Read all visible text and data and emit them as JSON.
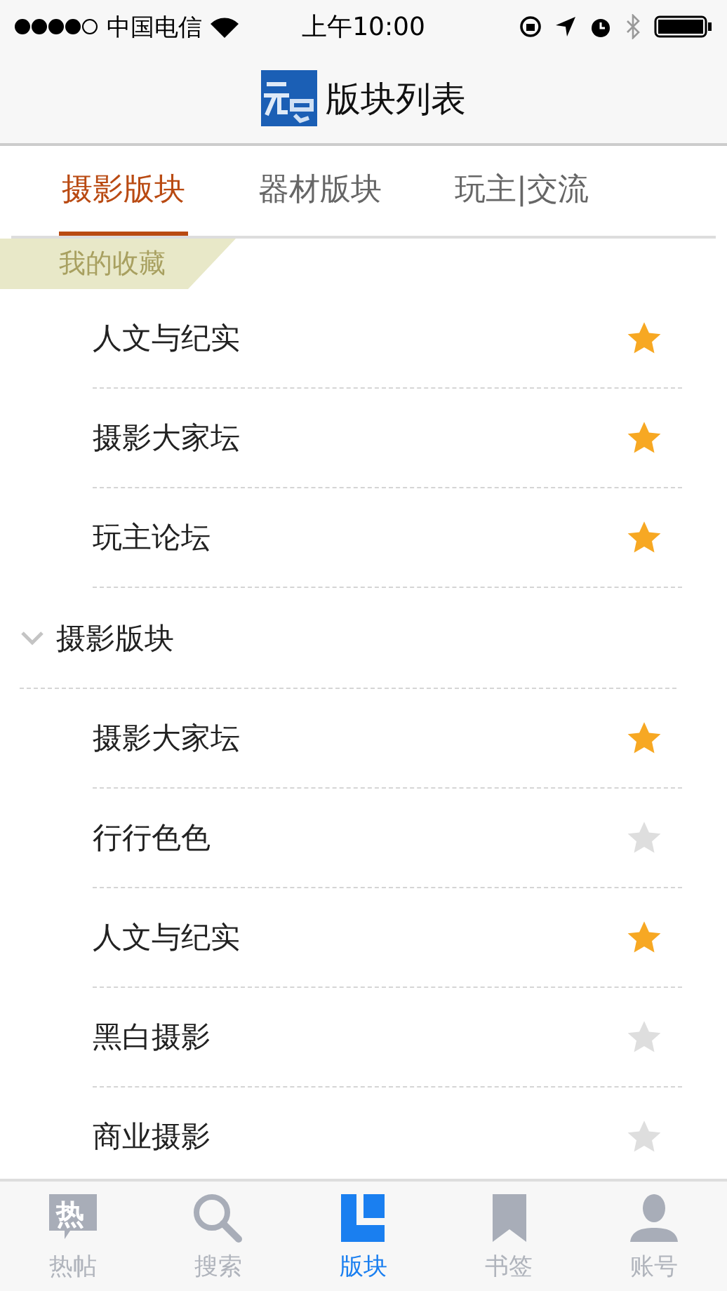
{
  "status_bar": {
    "carrier": "中国电信",
    "time": "上午10:00"
  },
  "nav": {
    "title": "版块列表"
  },
  "tabs": [
    {
      "label": "摄影版块",
      "selected": true
    },
    {
      "label": "器材版块",
      "selected": false
    },
    {
      "label": "玩主|交流",
      "selected": false
    }
  ],
  "favorites": {
    "title": "我的收藏",
    "items": [
      {
        "label": "人文与纪实",
        "favorited": true
      },
      {
        "label": "摄影大家坛",
        "favorited": true
      },
      {
        "label": "玩主论坛",
        "favorited": true
      }
    ]
  },
  "groups": [
    {
      "title": "摄影版块",
      "expanded": true,
      "items": [
        {
          "label": "摄影大家坛",
          "favorited": true
        },
        {
          "label": "行行色色",
          "favorited": false
        },
        {
          "label": "人文与纪实",
          "favorited": true
        },
        {
          "label": "黑白摄影",
          "favorited": false
        },
        {
          "label": "商业摄影",
          "favorited": false
        }
      ]
    }
  ],
  "tab_bar": [
    {
      "label": "热帖",
      "kind": "hot",
      "icon_text": "热",
      "selected": false
    },
    {
      "label": "搜索",
      "kind": "search",
      "selected": false
    },
    {
      "label": "版块",
      "kind": "boards",
      "selected": true
    },
    {
      "label": "书签",
      "kind": "bookmark",
      "selected": false
    },
    {
      "label": "账号",
      "kind": "account",
      "selected": false
    }
  ]
}
